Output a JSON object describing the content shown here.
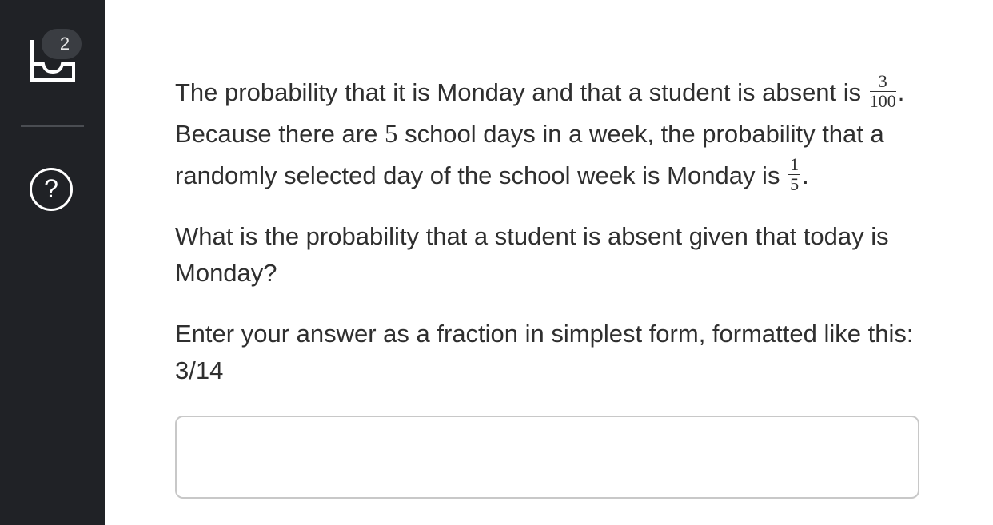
{
  "sidebar": {
    "tray_badge_count": "2",
    "help_icon_glyph": "?",
    "icons": [
      "tray-icon",
      "help-icon"
    ]
  },
  "question": {
    "p1_text_a": "The probability that it is Monday and that a student is absent is",
    "frac1_num": "3",
    "frac1_den": "100",
    "p1_text_b": ". Because there are ",
    "school_days": "5",
    "p1_text_c": " school days in a week, the probability that a randomly selected day of the school week is Monday is ",
    "frac2_num": "1",
    "frac2_den": "5",
    "p1_text_d": ".",
    "p2_text": "What is the probability that a student is absent given that today is Monday?",
    "p3_text": "Enter your answer as a fraction in simplest form, formatted like this: 3/14"
  },
  "answer": {
    "value": "",
    "placeholder": ""
  },
  "colors": {
    "sidebar_bg": "#202226",
    "text": "#2f2f2f",
    "input_border": "#c8c8c8"
  }
}
